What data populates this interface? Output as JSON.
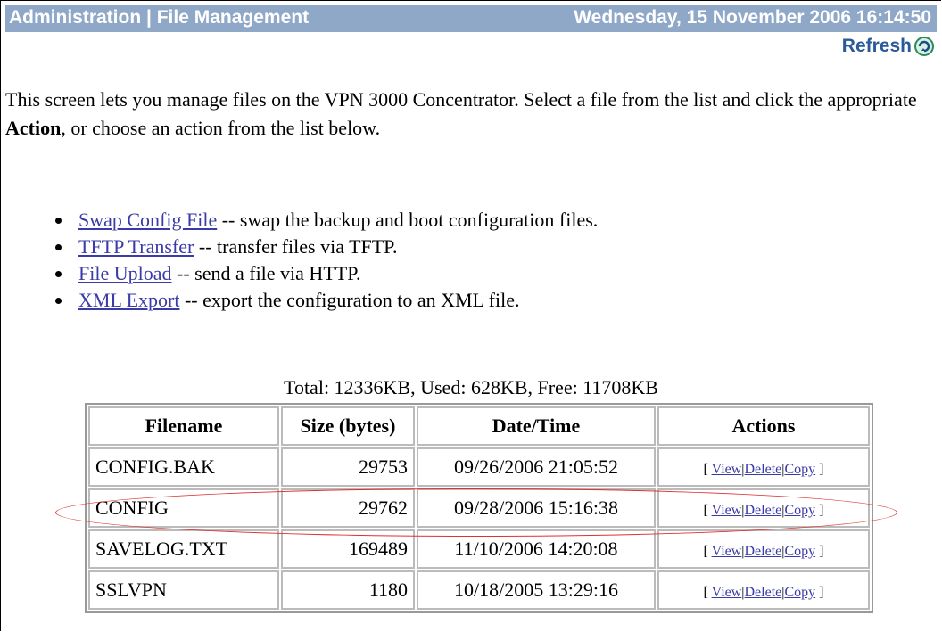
{
  "header": {
    "title": "Administration | File Management",
    "datetime": "Wednesday, 15 November 2006 16:14:50",
    "refresh_label": "Refresh",
    "refresh_icon": "refresh-icon"
  },
  "intro": {
    "part1": "This screen lets you manage files on the VPN 3000 Concentrator. Select a file from the list and click the appropriate ",
    "bold": "Action",
    "part2": ", or choose an action from the list below."
  },
  "links": [
    {
      "label": "Swap Config File",
      "desc": " -- swap the backup and boot configuration files."
    },
    {
      "label": "TFTP Transfer",
      "desc": " -- transfer files via TFTP."
    },
    {
      "label": "File Upload",
      "desc": " -- send a file via HTTP."
    },
    {
      "label": "XML Export",
      "desc": " -- export the configuration to an XML file."
    }
  ],
  "totals": "Total: 12336KB, Used: 628KB, Free: 11708KB",
  "table": {
    "headers": [
      "Filename",
      "Size (bytes)",
      "Date/Time",
      "Actions"
    ],
    "rows": [
      {
        "filename": "CONFIG.BAK",
        "size": "29753",
        "datetime": "09/26/2006 21:05:52"
      },
      {
        "filename": "CONFIG",
        "size": "29762",
        "datetime": "09/28/2006 15:16:38"
      },
      {
        "filename": "SAVELOG.TXT",
        "size": "169489",
        "datetime": "11/10/2006 14:20:08"
      },
      {
        "filename": "SSLVPN",
        "size": "1180",
        "datetime": "10/18/2005 13:29:16"
      }
    ],
    "actions": {
      "view": "View",
      "delete": "Delete",
      "copy": "Copy",
      "open": "[",
      "sep": "|",
      "close": "]"
    }
  },
  "colors": {
    "header_bg": "#8fa8c8",
    "link": "#3a3aa8",
    "highlight": "#e03030"
  }
}
